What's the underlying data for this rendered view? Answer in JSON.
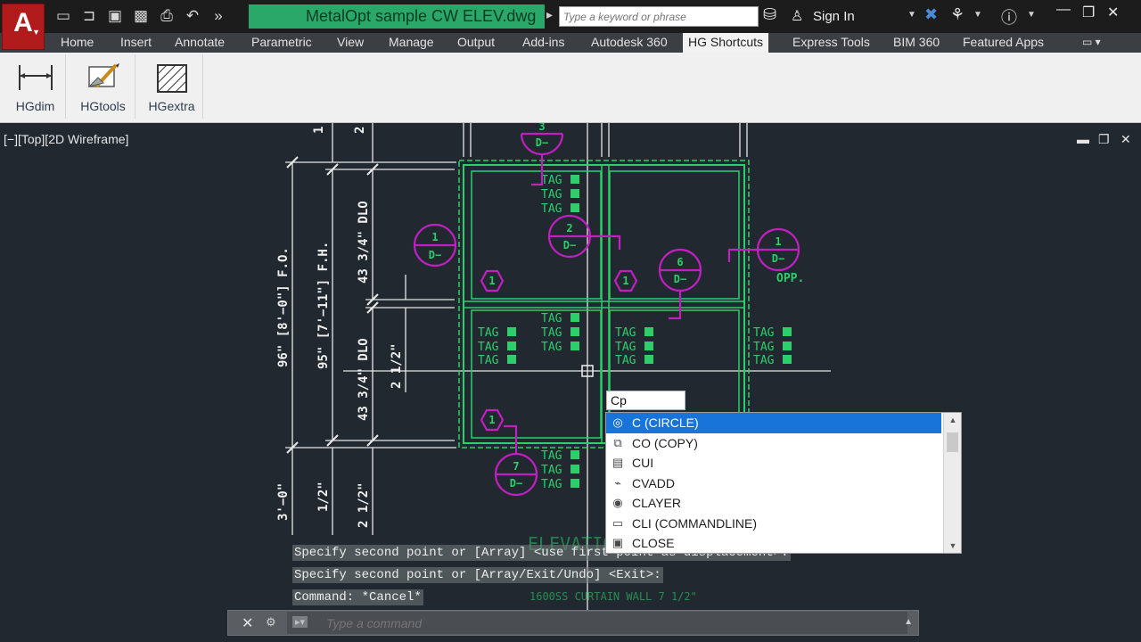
{
  "app": {
    "logo_letter": "A"
  },
  "quick_access": {
    "icons": [
      "new-file-icon",
      "open-folder-icon",
      "save-icon",
      "save-as-icon",
      "print-icon",
      "undo-icon",
      "more-icon"
    ],
    "glyphs": [
      "▭",
      "⊐",
      "▣",
      "▩",
      "⎙",
      "↶",
      "»"
    ]
  },
  "title": "MetalOpt sample CW ELEV.dwg",
  "search": {
    "placeholder": "Type a keyword or phrase"
  },
  "signin_label": "Sign In",
  "tabs": [
    "Home",
    "Insert",
    "Annotate",
    "Parametric",
    "View",
    "Manage",
    "Output",
    "Add-ins",
    "Autodesk 360",
    "HG Shortcuts",
    "Express Tools",
    "BIM 360",
    "Featured Apps"
  ],
  "active_tab": "HG Shortcuts",
  "ribbon_buttons": [
    {
      "label": "HGdim",
      "icon": "dimension-icon"
    },
    {
      "label": "HGtools",
      "icon": "tools-icon"
    },
    {
      "label": "HGextra",
      "icon": "hatch-icon"
    }
  ],
  "viewport_label": "[−][Top][2D Wireframe]",
  "drawing_text": {
    "dim_left_outer": "96\" [8'−0\"] F.O.",
    "dim_left_inner": "95\" [7'−11\"] F.H.",
    "dim_dlo_upper": "43 3/4\" DLO",
    "dim_dlo_lower": "43 3/4\" DLO",
    "dim_half_mid": "2 1/2\"",
    "dim_bottom_outer": "3'−0\"",
    "dim_bottom_mid": "1/2\"",
    "dim_bottom_inner": "2 1/2\"",
    "dim_top_1": "1",
    "dim_top_2": "2",
    "tag": "TAG",
    "opp": "OPP.",
    "bubble_d": "D−",
    "elevation_title": "ELEVATION",
    "curtain_wall": "1600SS CURTAIN WALL 7 1/2\""
  },
  "autocomplete": {
    "typed": "Cp",
    "items": [
      {
        "label": "C (CIRCLE)",
        "icon": "circle-icon"
      },
      {
        "label": "CO (COPY)",
        "icon": "copy-icon"
      },
      {
        "label": "CUI",
        "icon": "cui-icon"
      },
      {
        "label": "CVADD",
        "icon": "cvadd-icon"
      },
      {
        "label": "CLAYER",
        "icon": "layer-icon"
      },
      {
        "label": "CLI (COMMANDLINE)",
        "icon": "commandline-icon"
      },
      {
        "label": "CLOSE",
        "icon": "close-file-icon"
      }
    ],
    "selected_index": 0
  },
  "command_history": [
    "Specify second point or [Array] <use first point as displacement>:",
    "Specify second point or [Array/Exit/Undo] <Exit>:",
    "Command: *Cancel*"
  ],
  "command_line": {
    "placeholder": "Type a command"
  }
}
